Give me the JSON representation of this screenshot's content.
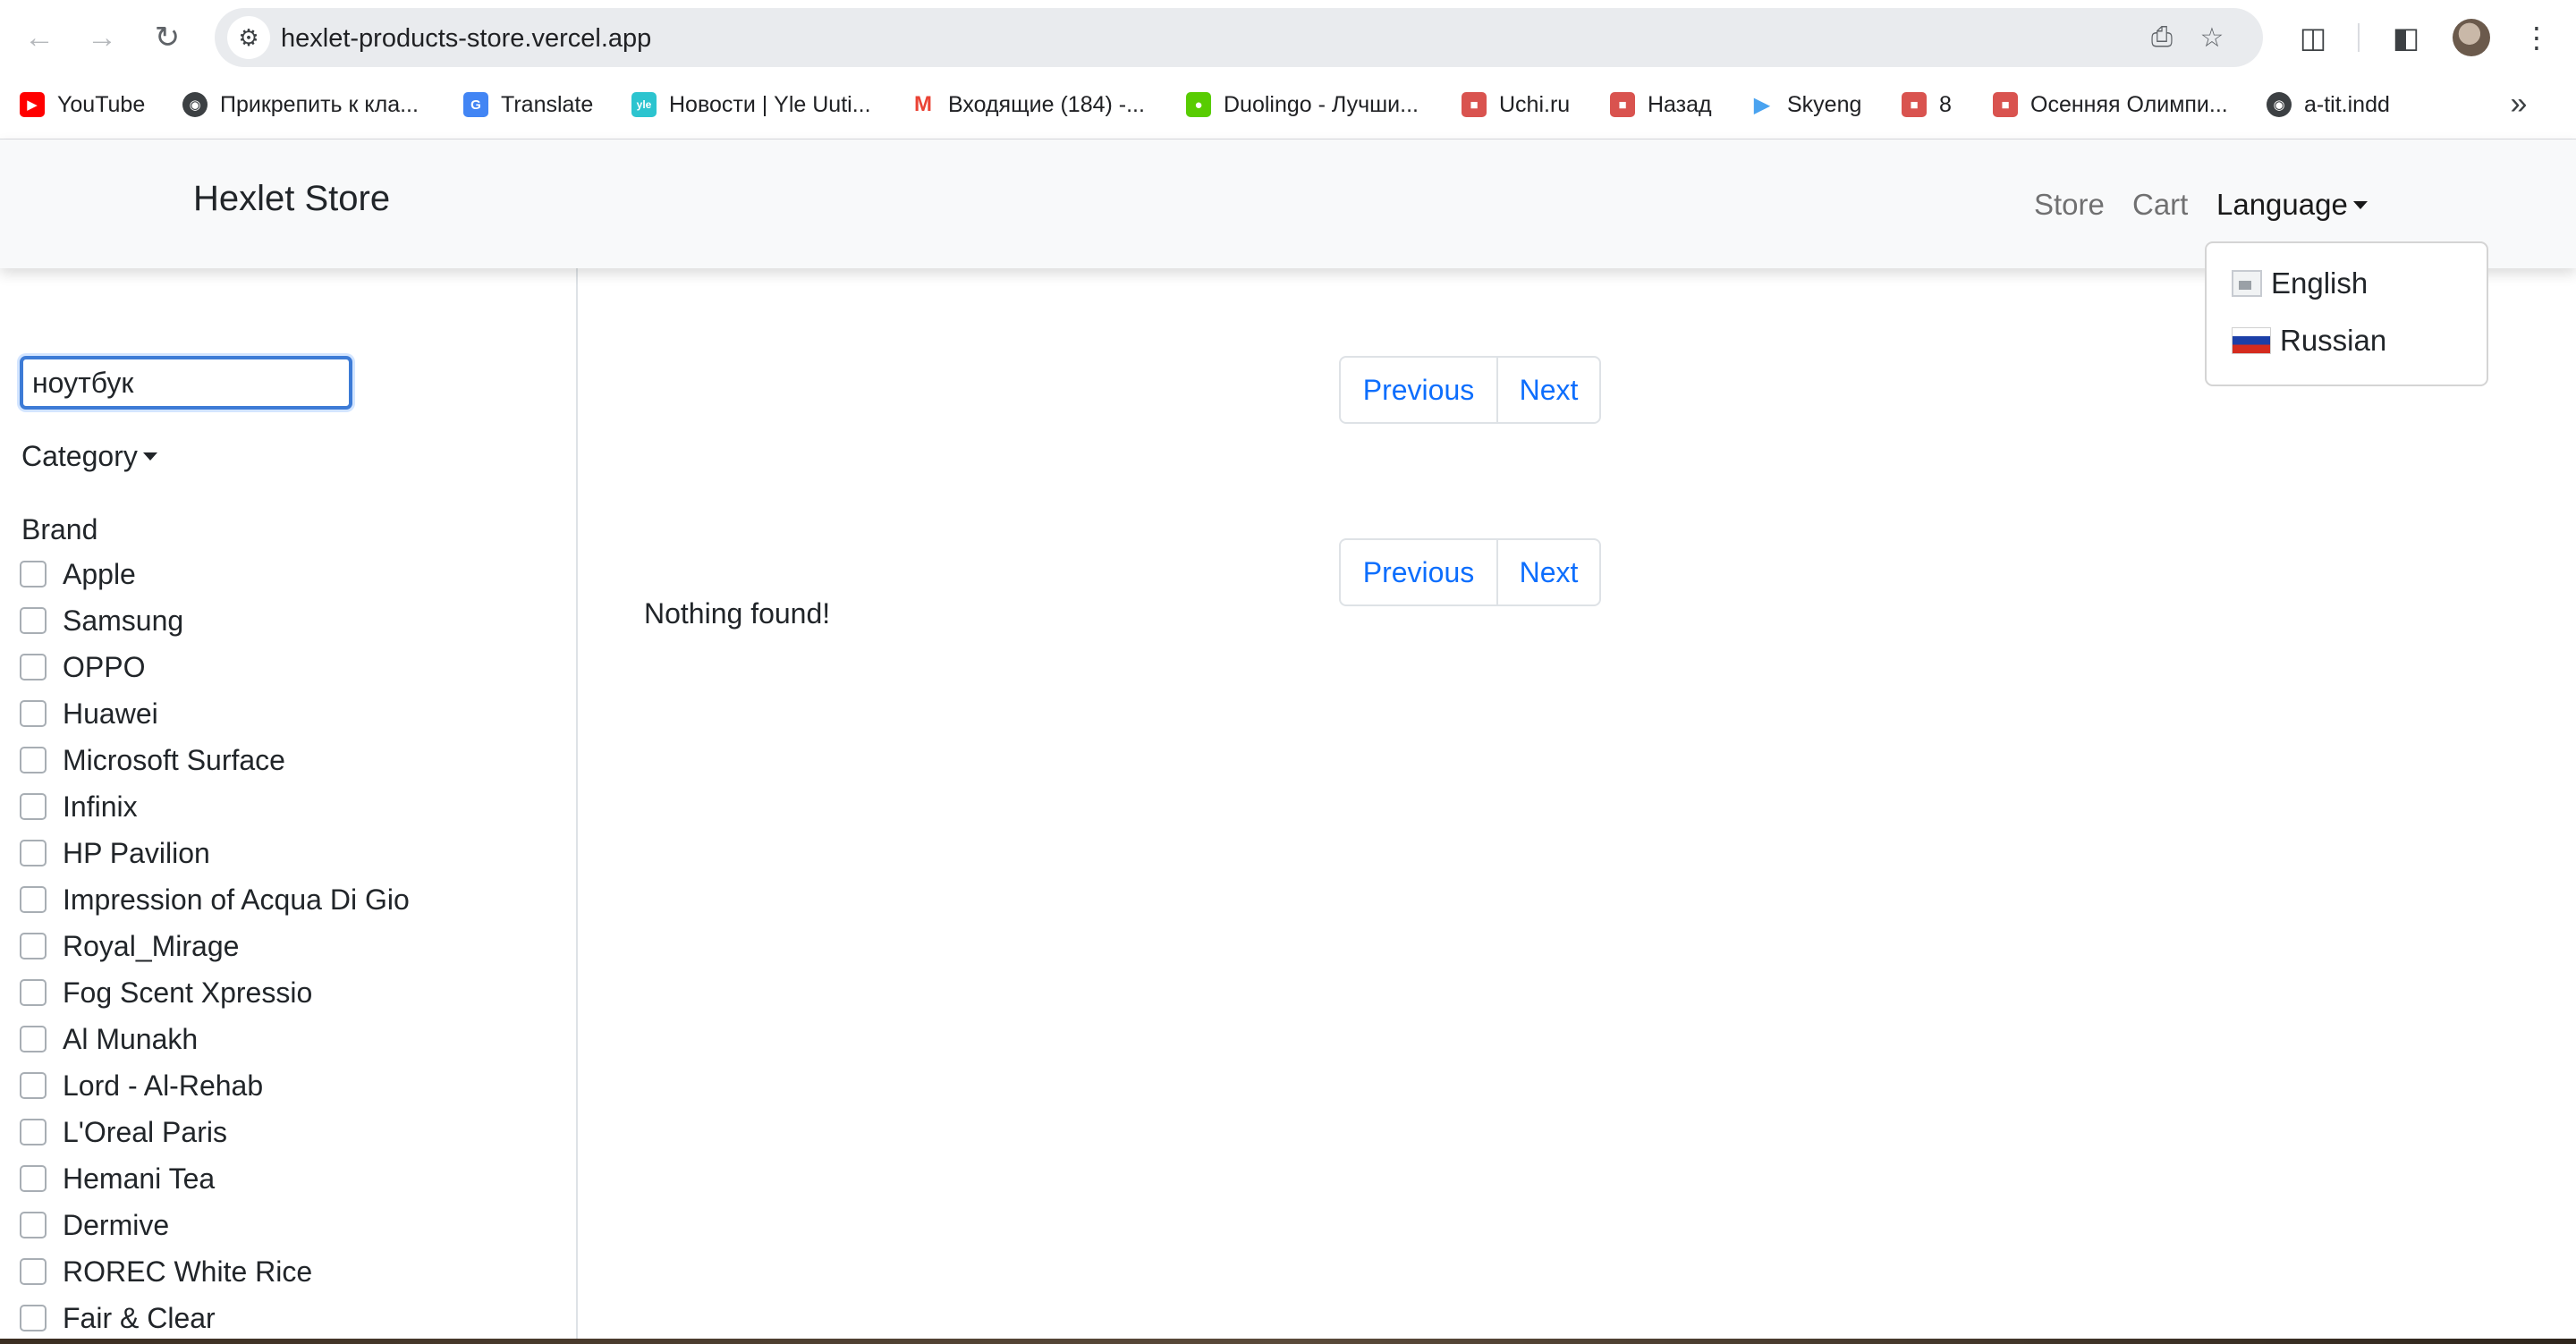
{
  "browser": {
    "url": "hexlet-products-store.vercel.app",
    "bookmarks": [
      {
        "label": "YouTube",
        "icon": "youtube-icon",
        "color": "#ff0000"
      },
      {
        "label": "Прикрепить к кла...",
        "icon": "globe-icon",
        "color": "#3c4043"
      },
      {
        "label": "Translate",
        "icon": "translate-icon",
        "color": "#4285f4"
      },
      {
        "label": "Новости | Yle Uuti...",
        "icon": "yle-icon",
        "color": "#2cc4cf"
      },
      {
        "label": "Входящие (184) -...",
        "icon": "gmail-icon",
        "color": "#ea4335"
      },
      {
        "label": "Duolingo - Лучши...",
        "icon": "duolingo-icon",
        "color": "#58cc02"
      },
      {
        "label": "Uchi.ru",
        "icon": "uchi-icon",
        "color": "#d9534f"
      },
      {
        "label": "Назад",
        "icon": "uchi-icon",
        "color": "#d9534f"
      },
      {
        "label": "Skyeng",
        "icon": "skyeng-icon",
        "color": "#4aa3f0"
      },
      {
        "label": "8",
        "icon": "uchi-icon",
        "color": "#d9534f"
      },
      {
        "label": "Осенняя Олимпи...",
        "icon": "uchi-icon",
        "color": "#d9534f"
      },
      {
        "label": "a-tit.indd",
        "icon": "globe-icon",
        "color": "#3c4043"
      }
    ]
  },
  "navbar": {
    "brand": "Hexlet Store",
    "links": {
      "store": "Store",
      "cart": "Cart",
      "language": "Language"
    },
    "language_menu": {
      "english": "English",
      "russian": "Russian"
    }
  },
  "sidebar": {
    "search_value": "ноутбук",
    "category_label": "Category",
    "brand_heading": "Brand",
    "brands": [
      "Apple",
      "Samsung",
      "OPPO",
      "Huawei",
      "Microsoft Surface",
      "Infinix",
      "HP Pavilion",
      "Impression of Acqua Di Gio",
      "Royal_Mirage",
      "Fog Scent Xpressio",
      "Al Munakh",
      "Lord - Al-Rehab",
      "L'Oreal Paris",
      "Hemani Tea",
      "Dermive",
      "ROREC White Rice",
      "Fair & Clear"
    ]
  },
  "main": {
    "pagination": {
      "previous": "Previous",
      "next": "Next"
    },
    "empty_message": "Nothing found!"
  },
  "colors": {
    "link": "#0d6efd",
    "navbar_bg": "#f8f9fa",
    "focus": "#3d7bd6"
  }
}
